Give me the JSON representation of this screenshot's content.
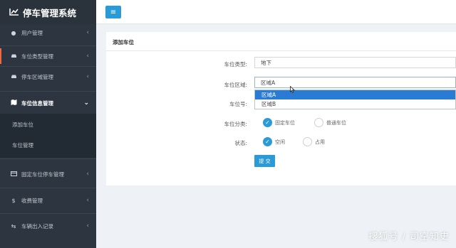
{
  "app": {
    "title": "停车管理系统"
  },
  "sidebar": {
    "items": [
      {
        "label": "用户管理",
        "icon": "user-icon"
      },
      {
        "label": "车位类型管理",
        "icon": "car-icon"
      },
      {
        "label": "停车区域管理",
        "icon": "car-icon"
      },
      {
        "label": "车位信息管理",
        "icon": "map-icon"
      },
      {
        "label": "固定车位停车管理",
        "icon": "card-icon"
      },
      {
        "label": "收费管理",
        "icon": "dollar-icon"
      },
      {
        "label": "车辆出入记录",
        "icon": "swap-icon"
      }
    ],
    "subitems": [
      {
        "label": "添加车位"
      },
      {
        "label": "车位管理"
      }
    ]
  },
  "topbar": {
    "menu_icon": "hamburger-icon"
  },
  "form": {
    "title": "添加车位",
    "type_label": "车位类型:",
    "type_value": "地下",
    "area_label": "车位区域:",
    "area_value": "区域A",
    "area_options": [
      "区域A",
      "区域B"
    ],
    "number_label": "车位号:",
    "category_label": "车位分类:",
    "category_options": [
      "固定车位",
      "普通车位"
    ],
    "status_label": "状态:",
    "status_options": [
      "空闲",
      "占用"
    ],
    "submit_label": "提 交"
  },
  "watermark": "搜狐号 / 司空知史",
  "colors": {
    "sidebar_bg": "#2c3540",
    "accent": "#2a9bd6",
    "highlight": "#2a7bd4",
    "active_marker": "#ec6a44"
  }
}
